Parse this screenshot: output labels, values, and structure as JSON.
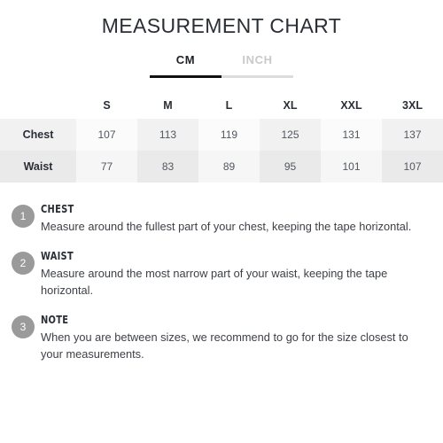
{
  "page": {
    "title": "MEASUREMENT CHART"
  },
  "unit_tabs": {
    "options": [
      {
        "label": "CM",
        "active": true
      },
      {
        "label": "INCH",
        "active": false
      }
    ],
    "selected": "CM"
  },
  "chart_data": {
    "type": "table",
    "title": "MEASUREMENT CHART",
    "unit": "CM",
    "corner_header": "",
    "categories": [
      "S",
      "M",
      "L",
      "XL",
      "XXL",
      "3XL"
    ],
    "series": [
      {
        "name": "Chest",
        "values": [
          107,
          113,
          119,
          125,
          131,
          137
        ]
      },
      {
        "name": "Waist",
        "values": [
          77,
          83,
          89,
          95,
          101,
          107
        ]
      }
    ],
    "shaded_columns": [
      "M",
      "XL",
      "3XL"
    ],
    "legend": "",
    "xlabel": "",
    "ylabel": ""
  },
  "notes": [
    {
      "number": "1",
      "heading": "CHEST",
      "text": "Measure around the fullest part of your chest, keeping the tape horizontal."
    },
    {
      "number": "2",
      "heading": "WAIST",
      "text": "Measure around the most narrow part of your waist, keeping the tape horizontal."
    },
    {
      "number": "3",
      "heading": "NOTE",
      "text": "When you are between sizes, we recommend to go for the size closest to your measurements."
    }
  ],
  "colors": {
    "title": "#2a2e35",
    "tab_active": "#111111",
    "tab_inactive": "#c9c9c9",
    "cell_shaded": "#f1f1f1",
    "cell_plain": "#fbfbfb",
    "note_circle": "#9a9a9a"
  }
}
